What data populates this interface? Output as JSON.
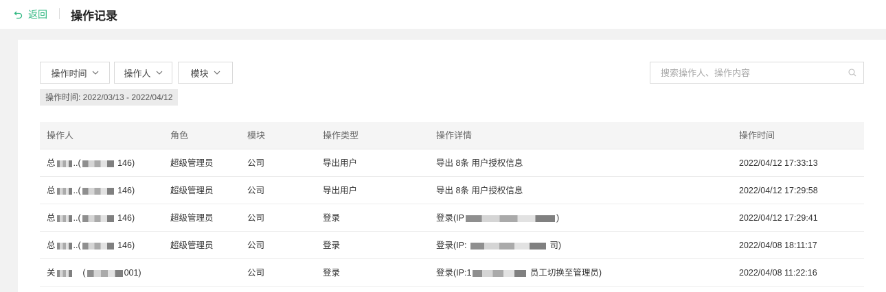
{
  "header": {
    "back_label": "返回",
    "title": "操作记录"
  },
  "filters": [
    {
      "label": "操作时间"
    },
    {
      "label": "操作人"
    },
    {
      "label": "模块"
    }
  ],
  "search": {
    "placeholder": "搜索操作人、操作内容",
    "value": ""
  },
  "active_filter_tag": "操作时间: 2022/03/13 - 2022/04/12",
  "table": {
    "columns": [
      "操作人",
      "角色",
      "模块",
      "操作类型",
      "操作详情",
      "操作时间"
    ],
    "rows": [
      {
        "operator_prefix": "总",
        "operator_suffix": "146)",
        "role": "超级管理员",
        "module": "公司",
        "type": "导出用户",
        "detail": "导出 8条 用户授权信息",
        "time": "2022/04/12 17:33:13"
      },
      {
        "operator_prefix": "总",
        "operator_suffix": "146)",
        "role": "超级管理员",
        "module": "公司",
        "type": "导出用户",
        "detail": "导出 8条 用户授权信息",
        "time": "2022/04/12 17:29:58"
      },
      {
        "operator_prefix": "总",
        "operator_suffix": "146)",
        "role": "超级管理员",
        "module": "公司",
        "type": "登录",
        "detail_prefix": "登录(IP",
        "detail_suffix": ")",
        "time": "2022/04/12 17:29:41"
      },
      {
        "operator_prefix": "总",
        "operator_suffix": "146)",
        "role": "超级管理员",
        "module": "公司",
        "type": "登录",
        "detail_prefix": "登录(IP:",
        "detail_suffix": "司)",
        "time": "2022/04/08 18:11:17"
      },
      {
        "operator_prefix": "关",
        "operator_suffix": "001)",
        "role": "",
        "module": "公司",
        "type": "登录",
        "detail_prefix": "登录(IP:1",
        "detail_suffix": "员工切换至管理员)",
        "time": "2022/04/08 11:22:16"
      }
    ]
  }
}
